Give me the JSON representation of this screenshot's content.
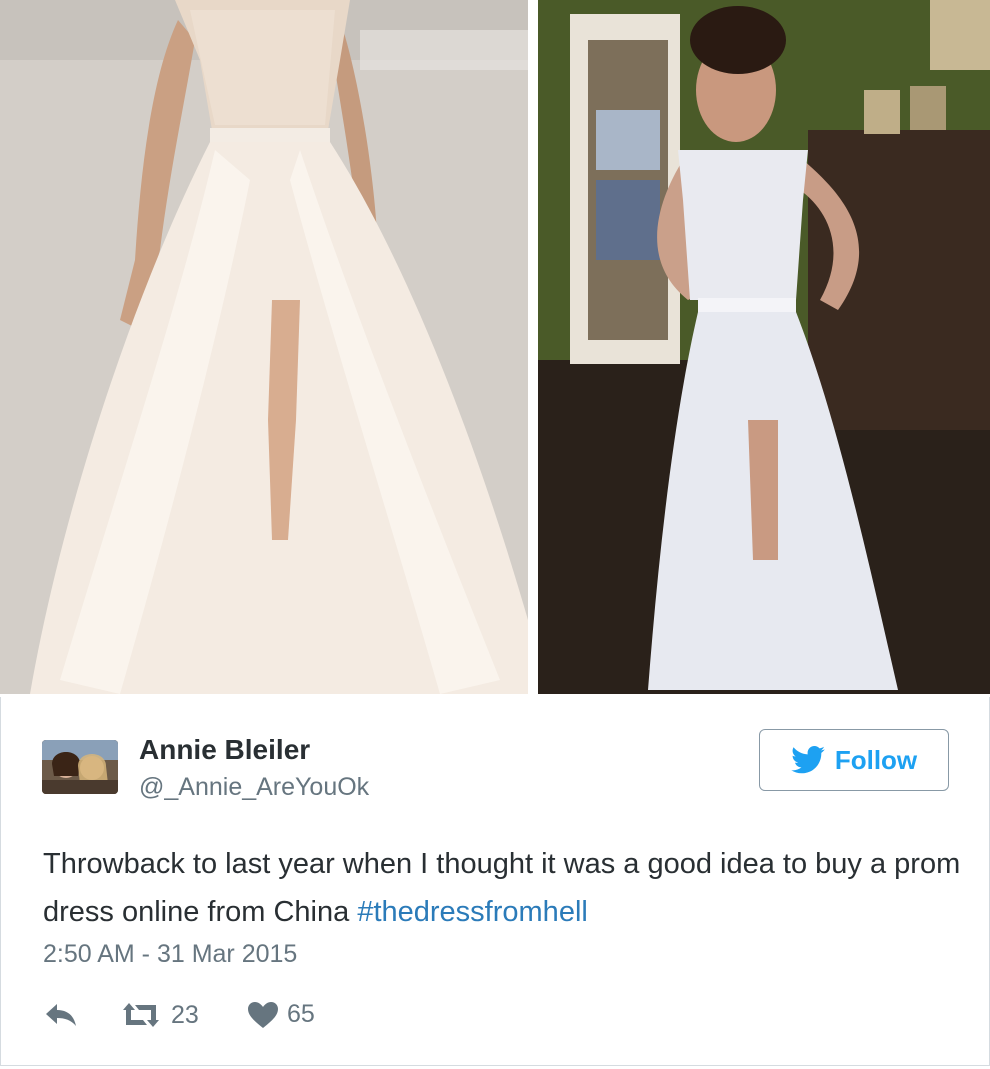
{
  "tweet": {
    "author_name": "Annie Bleiler",
    "author_handle": "@_Annie_AreYouOk",
    "follow_label": "Follow",
    "text_main": "Throwback to last year when I thought it was a good idea to buy a prom dress online from China ",
    "hashtag": "#thedressfromhell",
    "timestamp": "2:50 AM - 31 Mar 2015",
    "retweet_count": "23",
    "like_count": "65"
  },
  "icons": {
    "follow": "twitter-bird-icon",
    "reply": "reply-icon",
    "retweet": "retweet-icon",
    "like": "heart-icon"
  },
  "colors": {
    "brand_blue": "#1da1f2",
    "hashtag_blue": "#2b7bb9",
    "text_dark": "#292f33",
    "text_muted": "#66757f",
    "icon_gray": "#66757f"
  }
}
